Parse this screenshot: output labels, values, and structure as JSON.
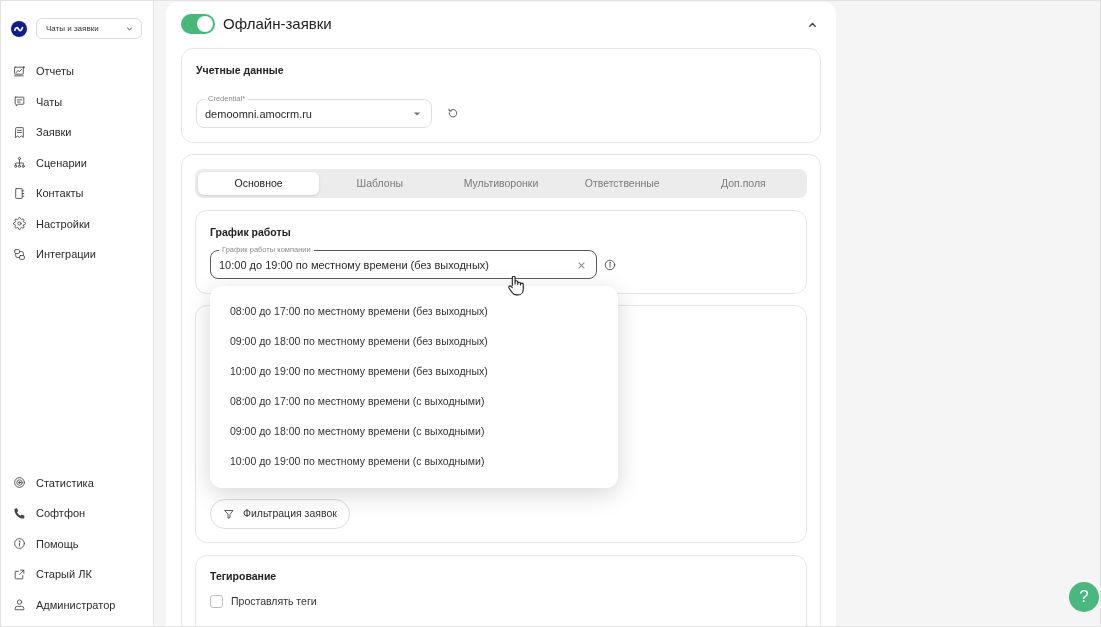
{
  "sidebar": {
    "workspace_select": {
      "value": "Чаты и заявки"
    },
    "nav_items": [
      {
        "label": "Отчеты",
        "selected": false
      },
      {
        "label": "Чаты",
        "selected": false
      },
      {
        "label": "Заявки",
        "selected": false
      },
      {
        "label": "Сценарии",
        "selected": false
      },
      {
        "label": "Контакты",
        "selected": false
      },
      {
        "label": "Настройки",
        "selected": false
      },
      {
        "label": "Интеграции",
        "selected": false
      }
    ],
    "bottom_items": [
      {
        "label": "Статистика",
        "selected": false
      },
      {
        "label": "Софтфон",
        "selected": false
      },
      {
        "label": "Помощь",
        "selected": false
      },
      {
        "label": "Старый ЛК",
        "selected": false
      },
      {
        "label": "Администратор",
        "selected": false
      }
    ]
  },
  "section": {
    "title": "Офлайн-заявки",
    "enabled": true,
    "expanded": true
  },
  "credentials": {
    "title": "Учетные данные",
    "field": {
      "label": "Credential*",
      "value": "demoomni.amocrm.ru",
      "focused": false
    }
  },
  "tabs": [
    {
      "label": "Основное",
      "selected": true
    },
    {
      "label": "Шаблоны",
      "selected": false
    },
    {
      "label": "Мультиворонки",
      "selected": false
    },
    {
      "label": "Ответственные",
      "selected": false
    },
    {
      "label": "Доп.поля",
      "selected": false
    }
  ],
  "schedule": {
    "title": "График работы",
    "field": {
      "label": "График работы компании",
      "value": "10:00 до 19:00 по местному времени (без выходных)",
      "focused": true,
      "open": true
    },
    "options": [
      {
        "label": "08:00 до 17:00 по местному времени (без выходных)",
        "selected": false
      },
      {
        "label": "09:00 до 18:00 по местному времени (без выходных)",
        "selected": false
      },
      {
        "label": "10:00 до 19:00 по местному времени (без выходных)",
        "selected": false
      },
      {
        "label": "08:00 до 17:00 по местному времени (с выходными)",
        "selected": false
      },
      {
        "label": "09:00 до 18:00 по местному времени (с выходными)",
        "selected": false
      },
      {
        "label": "10:00 до 19:00 по местному времени (с выходными)",
        "selected": false
      }
    ]
  },
  "filter_button": {
    "label": "Фильтрация заявок"
  },
  "tagging": {
    "title": "Тегирование",
    "checkbox": {
      "label": "Проставлять теги",
      "checked": false
    }
  },
  "help_button": {
    "label": "?"
  }
}
